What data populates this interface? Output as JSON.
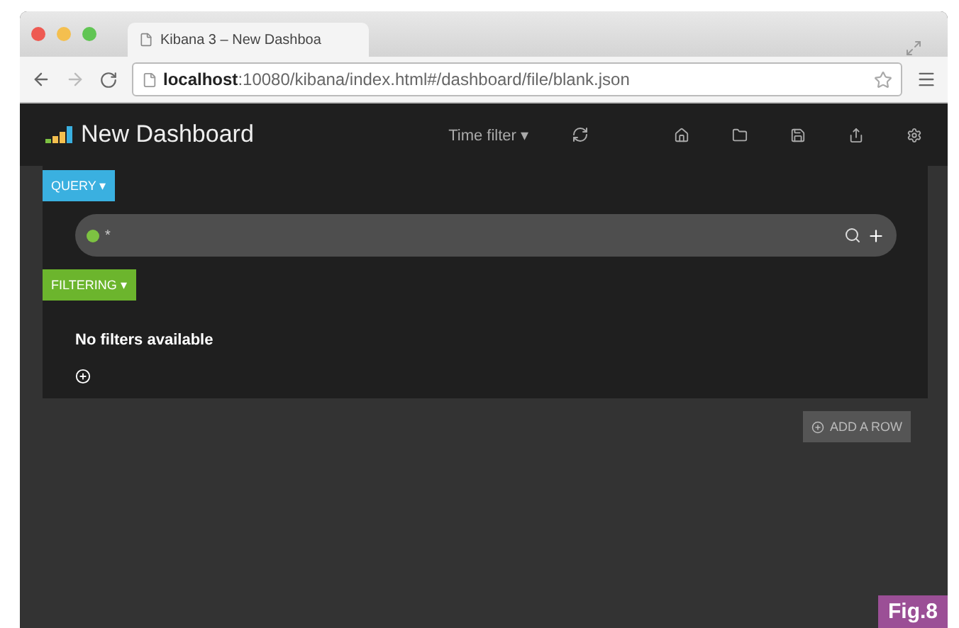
{
  "browser": {
    "tab_title": "Kibana 3 – New Dashboa",
    "url_host": "localhost",
    "url_path": ":10080/kibana/index.html#/dashboard/file/blank.json"
  },
  "navbar": {
    "title": "New Dashboard",
    "time_filter": "Time filter ▾"
  },
  "query": {
    "label": "QUERY ▾",
    "value": "*"
  },
  "filtering": {
    "label": "FILTERING ▾",
    "message": "No filters available"
  },
  "add_row": "ADD A ROW",
  "figure_label": "Fig.8"
}
